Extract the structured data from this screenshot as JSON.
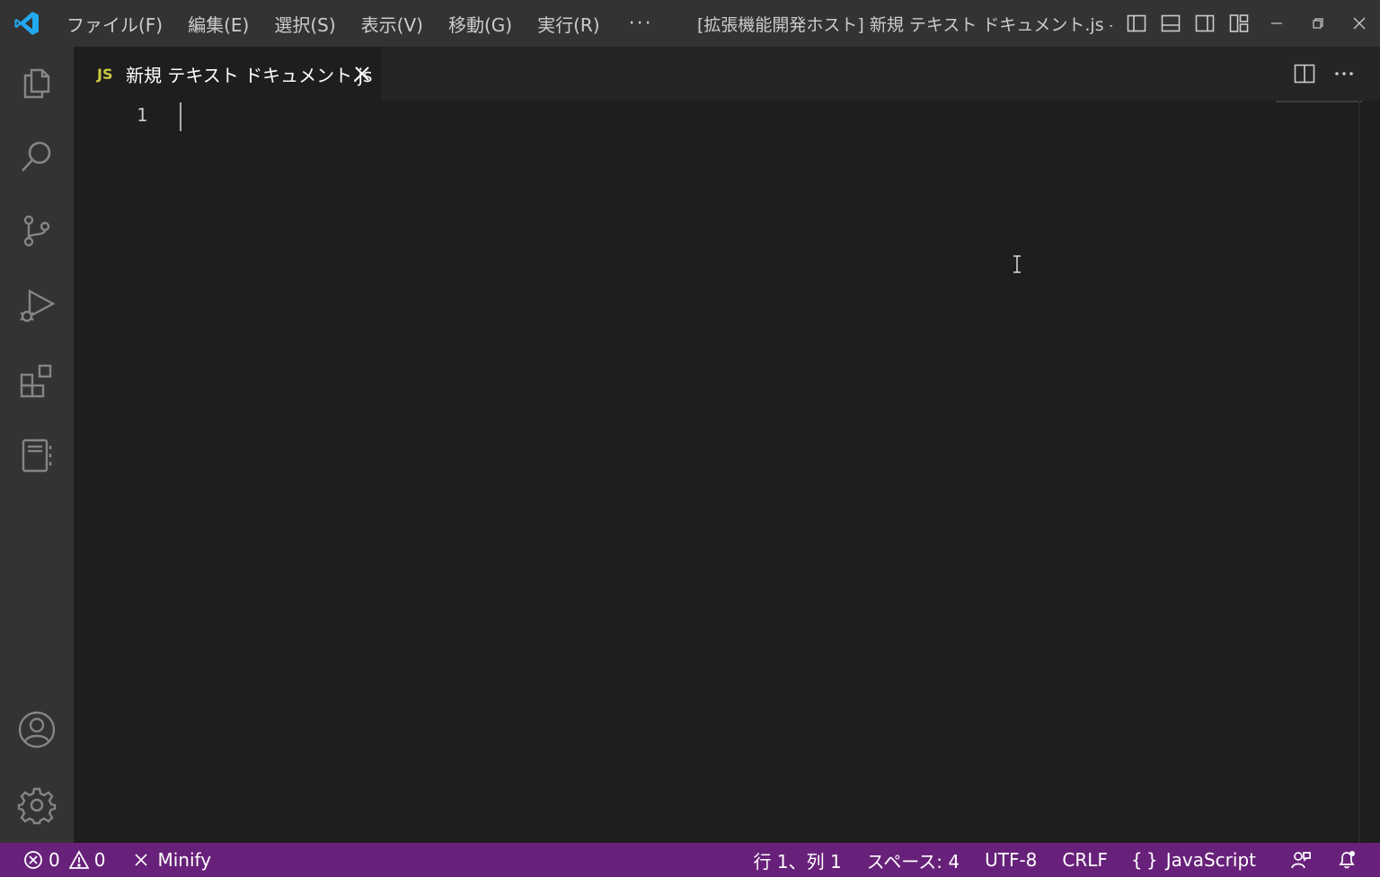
{
  "titlebar": {
    "menu": [
      "ファイル(F)",
      "編集(E)",
      "選択(S)",
      "表示(V)",
      "移動(G)",
      "実行(R)"
    ],
    "more": "···",
    "window_title": "[拡張機能開発ホスト] 新規 テキスト ドキュメント.js - Vi..."
  },
  "activity": [
    "files-icon",
    "search-icon",
    "source-control-icon",
    "run-debug-icon",
    "extensions-icon",
    "notebook-icon",
    "account-icon",
    "gear-icon"
  ],
  "tab": {
    "lang_badge": "JS",
    "label": "新規 テキスト ドキュメント.js"
  },
  "editor": {
    "line_numbers": [
      "1"
    ]
  },
  "statusbar": {
    "errors": "0",
    "warnings": "0",
    "minify": "Minify",
    "position": "行 1、列 1",
    "spaces": "スペース: 4",
    "encoding": "UTF-8",
    "eol": "CRLF",
    "language_braces": "{ }",
    "language": "JavaScript"
  },
  "colors": {
    "statusbar_bg": "#68217a",
    "accent": "#007acc",
    "js_badge": "#cbcb41"
  }
}
